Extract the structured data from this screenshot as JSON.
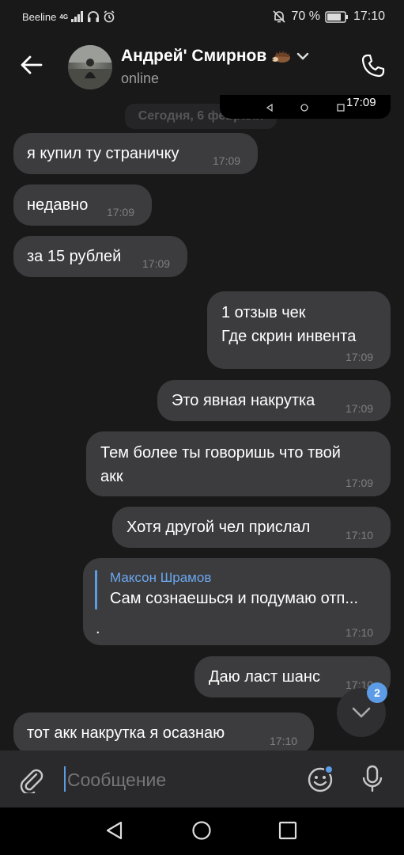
{
  "status_bar": {
    "carrier": "Beeline",
    "network": "4G",
    "battery": "70 %",
    "time": "17:10"
  },
  "header": {
    "contact_name": "Андрей' Смирнов",
    "presence": "online"
  },
  "pip": {
    "time": "17:09"
  },
  "date_divider": "Сегодня, 6 февраля",
  "messages": [
    {
      "text": "я купил ту страничку",
      "time": "17:09"
    },
    {
      "text": "недавно",
      "time": "17:09"
    },
    {
      "text": "за 15 рублей",
      "time": "17:09"
    },
    {
      "line1": "1 отзыв чек",
      "line2": "Где скрин инвента",
      "time": "17:09"
    },
    {
      "text": "Это явная накрутка",
      "time": "17:09"
    },
    {
      "line1": "Тем более ты говоришь что твой",
      "line2": "акк",
      "time": "17:09"
    },
    {
      "text": "Хотя другой чел прислал",
      "time": "17:10"
    },
    {
      "reply_author": "Максон Шрамов",
      "reply_text": "Сам сознаешься и подумаю отп...",
      "text": ".",
      "time": "17:10"
    },
    {
      "text": "Даю ласт шанс",
      "time": "17:10"
    },
    {
      "text": "тот акк накрутка я осазнаю",
      "time": "17:10"
    }
  ],
  "scroll_badge": "2",
  "composer": {
    "placeholder": "Сообщение"
  }
}
